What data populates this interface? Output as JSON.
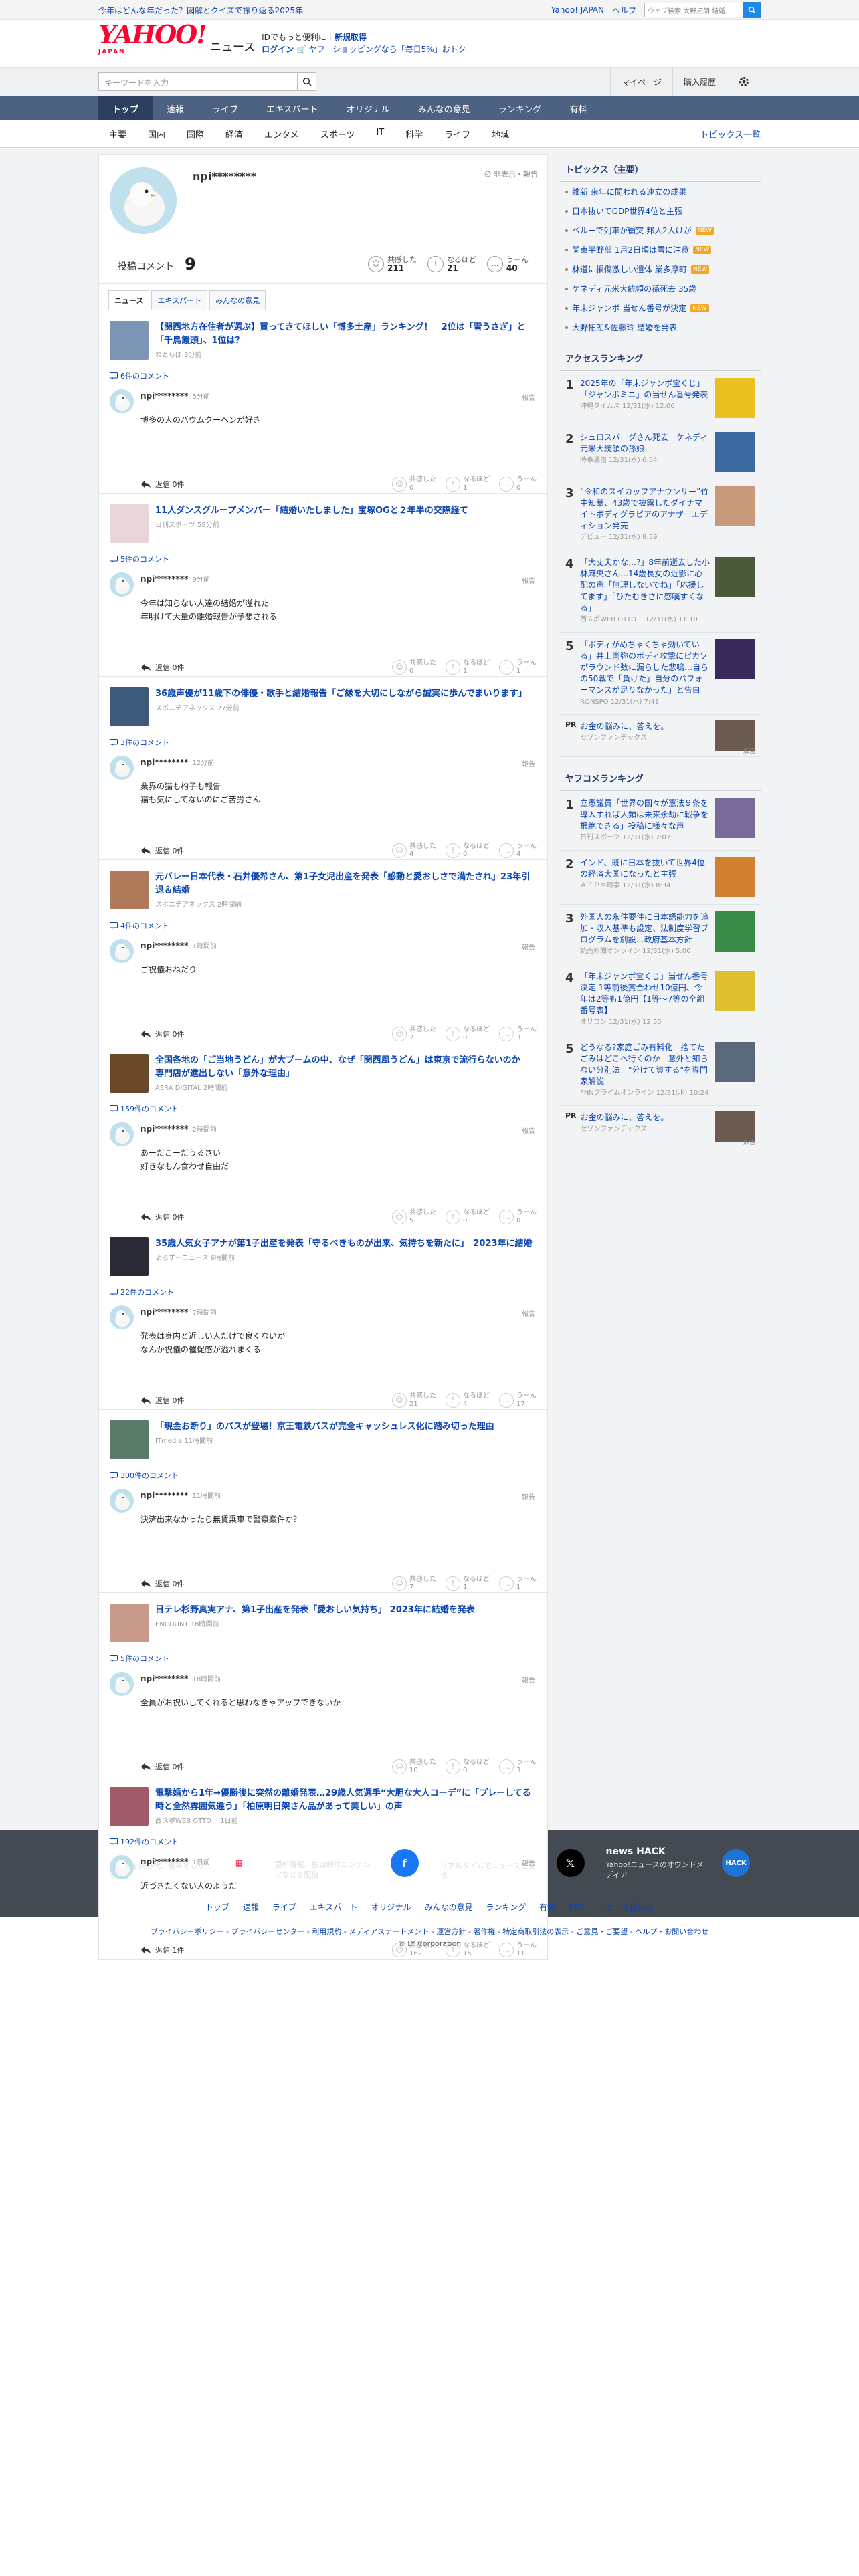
{
  "top_strip": {
    "promo": "今年はどんな年だった？図解とクイズで振り返る2025年",
    "links": [
      "Yahoo! JAPAN",
      "ヘルプ"
    ],
    "search_placeholder": "ウェブ検索",
    "search_value": "大野拓朗 結婚..."
  },
  "header": {
    "logo": "YAHOO!",
    "logo_sub": "JAPAN",
    "section": "ニュース",
    "promo_line1_a": "IDでもっと便利に",
    "promo_line1_b": "新規取得",
    "promo_login": "ログイン",
    "promo_line2": "ヤフーショッピングなら「毎日5%」おトク"
  },
  "search": {
    "placeholder": "キーワードを入力",
    "mypage": "マイページ",
    "subscribed": "購入履歴"
  },
  "global_nav": [
    "トップ",
    "速報",
    "ライブ",
    "エキスパート",
    "オリジナル",
    "みんなの意見",
    "ランキング",
    "有料"
  ],
  "category_nav": [
    "主要",
    "国内",
    "国際",
    "経済",
    "エンタメ",
    "スポーツ",
    "IT",
    "科学",
    "ライフ",
    "地域"
  ],
  "category_nav_right": "トピックス一覧",
  "profile": {
    "name": "npi********",
    "report": "非表示・報告",
    "comment_label": "投稿コメント",
    "comment_count": "9",
    "reactions": [
      {
        "label": "共感した",
        "value": "211",
        "icon": "smile-icon"
      },
      {
        "label": "なるほど",
        "value": "21",
        "icon": "exclaim-icon"
      },
      {
        "label": "うーん",
        "value": "40",
        "icon": "hmm-icon"
      }
    ]
  },
  "tabs": [
    "ニュース",
    "エキスパート",
    "みんなの意見"
  ],
  "posts": [
    {
      "title": "【関西地方在住者が選ぶ】買ってきてほしい「博多土産」ランキング！　2位は「雪うさぎ」と「千鳥饅頭」、1位は？",
      "source": "ねとらぼ 3分前",
      "comments": "6件のコメント",
      "time": "5分前",
      "text": "博多の人のバウムクーヘンが好き",
      "replies": "返信 0件",
      "r": [
        "0",
        "1",
        "0"
      ],
      "thumb": "#7c95b5"
    },
    {
      "title": "11人ダンスグループメンバー「結婚いたしました」宝塚OGと２年半の交際経て",
      "source": "日刊スポーツ 58分前",
      "comments": "5件のコメント",
      "time": "9分前",
      "text": "今年は知らない人達の結婚が溢れた\n年明けて大量の離婚報告が予想される",
      "replies": "返信 0件",
      "r": [
        "0",
        "1",
        "1"
      ],
      "thumb": "#e8d5d8"
    },
    {
      "title": "36歳声優が11歳下の俳優・歌手と結婚報告「ご縁を大切にしながら誠実に歩んでまいります」",
      "source": "スポニチアネックス 27分前",
      "comments": "3件のコメント",
      "time": "12分前",
      "text": "業界の猫も杓子も報告\n猫も気にしてないのにご苦労さん",
      "replies": "返信 0件",
      "r": [
        "4",
        "0",
        "4"
      ],
      "thumb": "#3e5a7a"
    },
    {
      "title": "元バレー日本代表・石井優希さん、第1子女児出産を発表「感動と愛おしさで満たされ」23年引退＆結婚",
      "source": "スポニチアネックス 2時間前",
      "comments": "4件のコメント",
      "time": "1時間前",
      "text": "ご祝儀おねだり",
      "replies": "返信 0件",
      "r": [
        "2",
        "0",
        "3"
      ],
      "thumb": "#b07a5a"
    },
    {
      "title": "全国各地の「ご当地うどん」が大ブームの中、なぜ「関西風うどん」は東京で流行らないのか　専門店が進出しない「意外な理由」",
      "source": "AERA DIGITAL 2時間前",
      "comments": "159件のコメント",
      "time": "2時間前",
      "text": "あーだこーだうるさい\n好きなもん食わせ自由だ",
      "replies": "返信 0件",
      "r": [
        "5",
        "0",
        "0"
      ],
      "thumb": "#6a4a2a"
    },
    {
      "title": "35歳人気女子アナが第1子出産を発表「守るべきものが出来、気持ちを新たに」　2023年に結婚",
      "source": "よろずーニュース 6時間前",
      "comments": "22件のコメント",
      "time": "7時間前",
      "text": "発表は身内と近しい人だけで良くないか\nなんか祝儀の催促感が溢れまくる",
      "replies": "返信 0件",
      "r": [
        "21",
        "4",
        "17"
      ],
      "thumb": "#2a2a34"
    },
    {
      "title": "「現金お断り」のバスが登場！京王電鉄バスが完全キャッシュレス化に踏み切った理由",
      "source": "ITmedia 11時間前",
      "comments": "300件のコメント",
      "time": "11時間前",
      "text": "決済出来なかったら無賃乗車で警察案件か？",
      "replies": "返信 0件",
      "r": [
        "7",
        "1",
        "1"
      ],
      "thumb": "#5a7a6a"
    },
    {
      "title": "日テレ杉野真実アナ、第1子出産を発表「愛おしい気持ち」 2023年に結婚を発表",
      "source": "ENCOUNT 18時間前",
      "comments": "5件のコメント",
      "time": "18時間前",
      "text": "全員がお祝いしてくれると思わなきゃアップできないか",
      "replies": "返信 0件",
      "r": [
        "10",
        "0",
        "3"
      ],
      "thumb": "#c89a8a"
    },
    {
      "title": "電撃婚から1年→優勝後に突然の離婚発表…29歳人気選手“大胆な大人コーデ”に「プレーしてる時と全然雰囲気違う」「柏原明日架さん品があって美しい」の声",
      "source": "西スポWEB OTTO！ 1日前",
      "comments": "192件のコメント",
      "time": "1日前",
      "text": "近づきたくない人のようだ",
      "replies": "返信 1件",
      "r": [
        "162",
        "15",
        "11"
      ],
      "thumb": "#a05a6a"
    }
  ],
  "sidebar": {
    "topics_title": "トピックス（主要）",
    "topics": [
      {
        "t": "維新 来年に問われる連立の成果",
        "tag": ""
      },
      {
        "t": "日本抜いてGDP世界4位と主張",
        "tag": ""
      },
      {
        "t": "ベルーで列車が衝突 邦人2人けが",
        "tag": "NEW"
      },
      {
        "t": "関東平野部 1月2日頃は雪に注意",
        "tag": "NEW"
      },
      {
        "t": "林道に損傷激しい遺体 業多摩町",
        "tag": "NEW"
      },
      {
        "t": "ケネディ元米大統領の孫死去 35歳",
        "tag": ""
      },
      {
        "t": "年末ジャンボ 当せん番号が決定",
        "tag": "NEW"
      },
      {
        "t": "大野拓朗&佐藤玲 結婚を発表",
        "tag": ""
      }
    ],
    "access_title": "アクセスランキング",
    "access": [
      {
        "t": "2025年の「年末ジャンボ宝くじ」「ジャンボミニ」の当せん番号発表",
        "m": "沖縄タイムス 12/31(水) 12:06",
        "c": "#e8c020"
      },
      {
        "t": "シュロスバーグさん死去　ケネディ元米大統領の孫娘",
        "m": "時事通信 12/31(水) 6:54",
        "c": "#3a6aa0"
      },
      {
        "t": "“令和のスイカップアナウンサー”竹中知華、43歳で披露したダイナマイトボディグラビアのアナザーエディション発売",
        "m": "デビュー 12/31(水) 8:59",
        "c": "#c89a7a"
      },
      {
        "t": "「大丈夫かな…?」8年前逝去した小林麻央さん…14歳長女の近影に心配の声「無理しないでね」「応援してます」「ひたむきさに感嘆すくなる」",
        "m": "西スポWEB OTTO！ 12/31(水) 11:10",
        "c": "#4a5a3a"
      },
      {
        "t": "「ボディがめちゃくちゃ効いている」井上尚弥のボディ攻撃にピカソがラウンド数に漏らした悲鳴…自らの50戦で「負けた」自分のパフォーマンスが足りなかった」と告白",
        "m": "RONSPO 12/31(水) 7:41",
        "c": "#3a2a5a"
      }
    ],
    "ad_text": "お金の悩みに、答えを。",
    "ad_sub": "セゾンファンデックス",
    "ad_label": "広告",
    "pr": "PR",
    "yahoo_title": "ヤフコメランキング",
    "yahoo": [
      {
        "t": "立憲議員「世界の国々が憲法９条を導入すれば人類は未来永劫に戦争を根絶できる」投稿に様々な声",
        "m": "日刊スポーツ 12/31(水) 7:07",
        "c": "#7a6a9a"
      },
      {
        "t": "インド、既に日本を抜いて世界4位の経済大国になったと主張",
        "m": "ＡＦＰ＝時事 12/31(水) 8:34",
        "c": "#d08030"
      },
      {
        "t": "外国人の永住要件に日本語能力を追加・収入基準も設定、法制度学習プログラムを創設…政府基本方針",
        "m": "読売新聞オンライン 12/31(水) 5:00",
        "c": "#3a8a4a"
      },
      {
        "t": "「年末ジャンボ宝くじ」当せん番号決定 1等前後賞合わせ10億円、今年は2等も1億円【1等〜7等の全組番号表】",
        "m": "オリコン 12/31(水) 12:55",
        "c": "#e0c030"
      },
      {
        "t": "どうなる?家庭ごみ有料化　捨てたごみはどこへ行くのか　意外と知らない分別法　\"分けて資する\"を専門家解説",
        "m": "FNNプライムオンライン 12/31(水) 10:24",
        "c": "#5a6a7a"
      }
    ]
  },
  "footer": {
    "apps": [
      {
        "title": "アプリ",
        "desc": "データを読み代、電車でもサクサク",
        "icon": "app-icon"
      },
      {
        "title": "Facebook",
        "desc": "更新情報、独自制作コンテンツなどを配信",
        "icon": "facebook-icon"
      },
      {
        "title": "X（旧Twitter）",
        "desc": "リアルタイムでニュースを配信",
        "icon": "x-icon"
      },
      {
        "title": "news HACK",
        "desc": "Yahoo!ニュースのオウンドメディア",
        "icon": "newshack-icon"
      }
    ],
    "nav": [
      "トップ",
      "速報",
      "ライブ",
      "エキスパート",
      "オリジナル",
      "みんなの意見",
      "ランキング",
      "有料",
      "RSS",
      "ニュース提供社"
    ],
    "legal1": "プライバシーポリシー - プライバシーセンター - 利用規約 - メディアステートメント - 運営方針 - 著作権 - 特定商取引法の表示 - ご意見・ご要望 - ヘルプ・お問い合わせ",
    "copyright": "© LY Corporation"
  }
}
